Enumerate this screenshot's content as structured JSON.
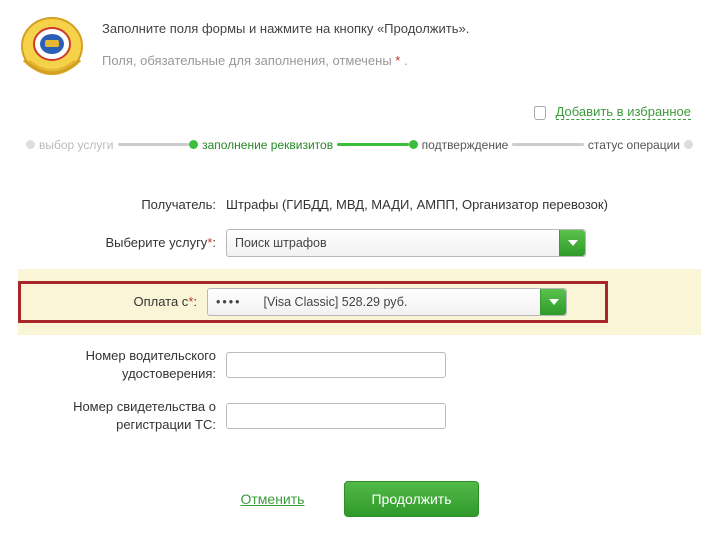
{
  "header": {
    "line1": "Заполните поля формы и нажмите на кнопку «Продолжить».",
    "line2_pre": "Поля, обязательные для заполнения, отмечены ",
    "line2_mark": "*",
    "line2_post": " ."
  },
  "favorite": {
    "label": "Добавить в избранное"
  },
  "steps": {
    "s1": "выбор услуги",
    "s2": "заполнение реквизитов",
    "s3": "подтверждение",
    "s4": "статус операции"
  },
  "form": {
    "recipient_label": "Получатель:",
    "recipient_value": "Штрафы (ГИБДД, МВД, МАДИ, АМПП, Организатор перевозок)",
    "service_label": "Выберите услугу",
    "service_mark": "*",
    "service_colon": ":",
    "service_value": "Поиск штрафов",
    "payfrom_label": "Оплата с",
    "payfrom_mark": "*",
    "payfrom_colon": ":",
    "payfrom_mask": "••••",
    "payfrom_value": "[Visa Classic] 528.29 руб.",
    "drvlic_label": "Номер водительского удостоверения:",
    "regcert_label": "Номер свидетельства о регистрации ТС:"
  },
  "footer": {
    "cancel": "Отменить",
    "continue": "Продолжить"
  }
}
